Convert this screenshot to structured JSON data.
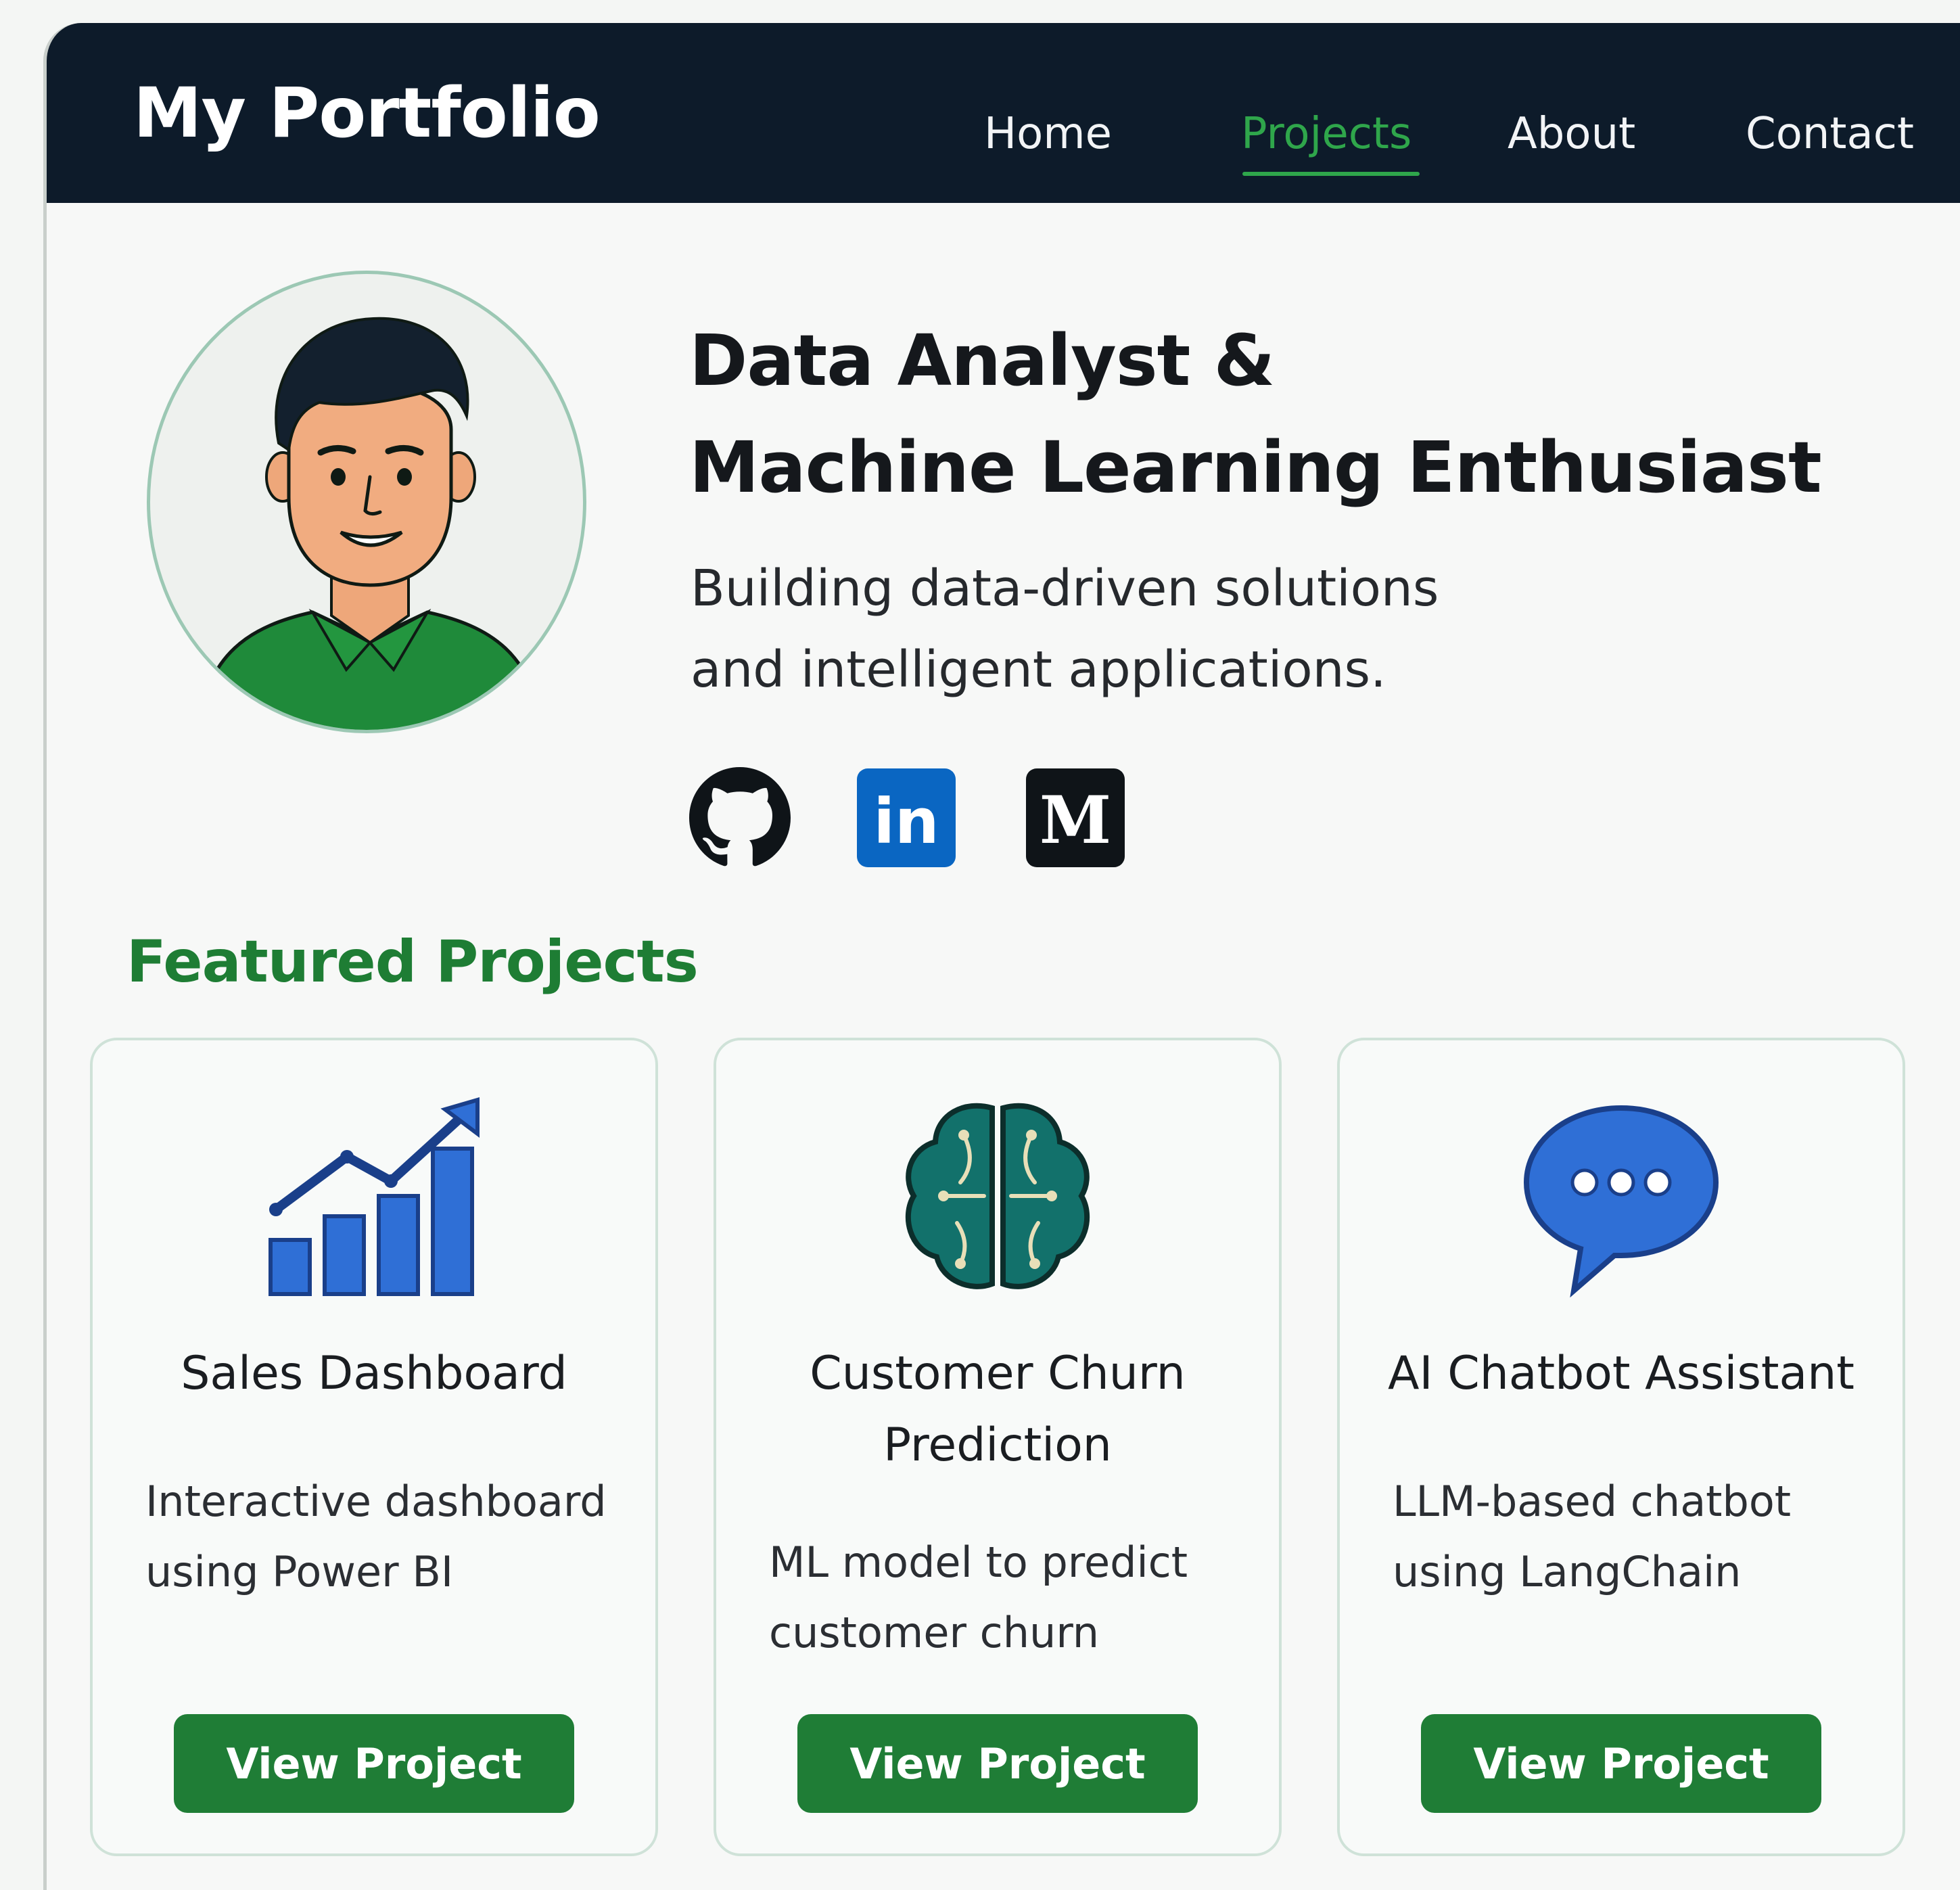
{
  "navbar": {
    "brand": "My Portfolio",
    "links": [
      {
        "label": "Home",
        "active": false
      },
      {
        "label": "Projects",
        "active": true
      },
      {
        "label": "About",
        "active": false
      },
      {
        "label": "Contact",
        "active": false
      }
    ]
  },
  "hero": {
    "headline_line1": "Data Analyst &",
    "headline_line2": "Machine Learning Enthusiast",
    "subline_line1": "Building data-driven solutions",
    "subline_line2": "and intelligent applications.",
    "social": [
      {
        "icon": "github-icon"
      },
      {
        "icon": "linkedin-icon",
        "text": "in"
      },
      {
        "icon": "medium-icon",
        "text": "M"
      }
    ]
  },
  "featured": {
    "title": "Featured Projects",
    "projects": [
      {
        "icon": "bar-chart-trend-icon",
        "title": "Sales Dashboard",
        "desc_line1": "Interactive dashboard",
        "desc_line2": "using Power BI",
        "button": "View Project"
      },
      {
        "icon": "brain-icon",
        "title_line1": "Customer Churn",
        "title_line2": "Prediction",
        "desc_line1": "ML model to predict",
        "desc_line2": "customer churn",
        "button": "View Project"
      },
      {
        "icon": "chat-bubble-icon",
        "title": "AI Chatbot Assistant",
        "desc_line1": "LLM-based chatbot",
        "desc_line2": "using LangChain",
        "button": "View Project"
      }
    ]
  },
  "colors": {
    "navbar_bg": "#0d1b2a",
    "accent_green": "#1f7d36",
    "active_link": "#2fa64b",
    "linkedin_blue": "#0a66c2",
    "chart_blue": "#2f6fd6",
    "brain_teal": "#12716b"
  }
}
